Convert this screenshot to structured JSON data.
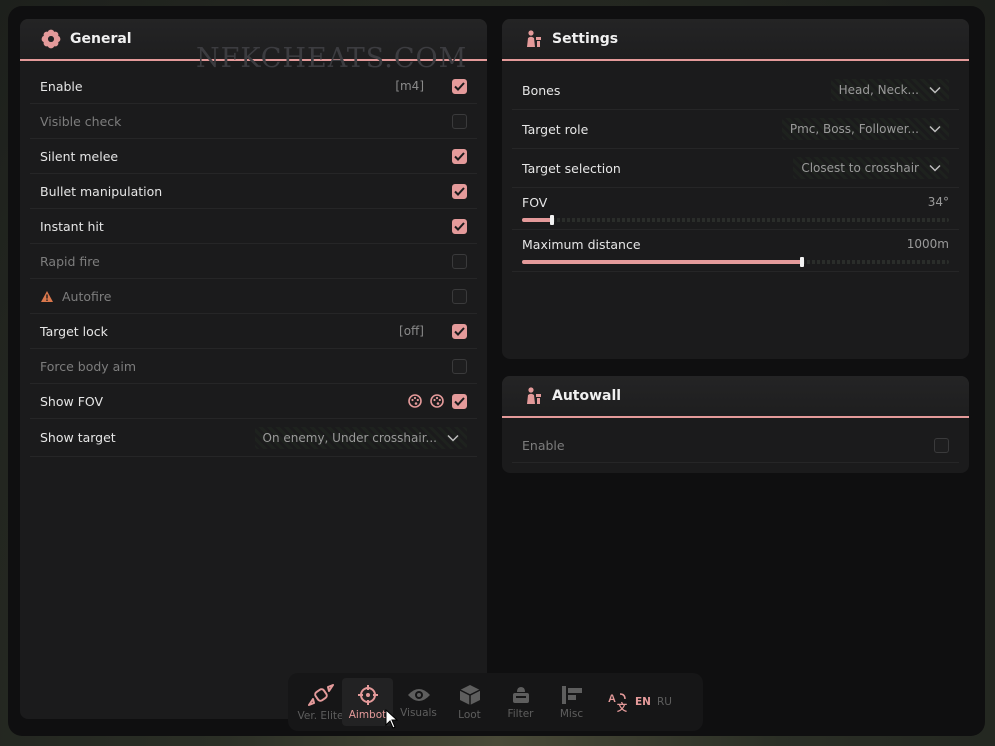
{
  "watermark": "NFKCHEATS.COM",
  "general": {
    "title": "General",
    "rows": [
      {
        "label": "Enable",
        "key": "[m4]",
        "checked": true,
        "disabled": false
      },
      {
        "label": "Visible check",
        "key": "",
        "checked": false,
        "disabled": true
      },
      {
        "label": "Silent melee",
        "key": "",
        "checked": true,
        "disabled": false
      },
      {
        "label": "Bullet manipulation",
        "key": "",
        "checked": true,
        "disabled": false
      },
      {
        "label": "Instant hit",
        "key": "",
        "checked": true,
        "disabled": false
      },
      {
        "label": "Rapid fire",
        "key": "",
        "checked": false,
        "disabled": true
      },
      {
        "label": "Autofire",
        "key": "",
        "checked": false,
        "disabled": true,
        "icon": "warning-icon"
      },
      {
        "label": "Target lock",
        "key": "[off]",
        "checked": true,
        "disabled": false
      },
      {
        "label": "Force body aim",
        "key": "",
        "checked": false,
        "disabled": true
      },
      {
        "label": "Show FOV",
        "key": "",
        "checked": true,
        "disabled": false,
        "colors": [
          "palette-icon",
          "palette-icon"
        ]
      }
    ],
    "show_target": {
      "label": "Show target",
      "value": "On enemy, Under crosshair..."
    }
  },
  "settings": {
    "title": "Settings",
    "dropdowns": [
      {
        "label": "Bones",
        "value": "Head, Neck..."
      },
      {
        "label": "Target role",
        "value": "Pmc, Boss, Follower..."
      },
      {
        "label": "Target selection",
        "value": "Closest to crosshair"
      }
    ],
    "sliders": [
      {
        "label": "FOV",
        "value_text": "34°",
        "fraction": 0.07
      },
      {
        "label": "Maximum distance",
        "value_text": "1000m",
        "fraction": 0.655
      }
    ]
  },
  "autowall": {
    "title": "Autowall",
    "enable_label": "Enable",
    "enabled": false
  },
  "nav": {
    "items": [
      {
        "name": "ver-elite",
        "label": "Ver. Elite",
        "icon": "candy-icon",
        "active": false
      },
      {
        "name": "aimbot",
        "label": "Aimbot",
        "icon": "crosshair-icon",
        "active": true
      },
      {
        "name": "visuals",
        "label": "Visuals",
        "icon": "eye-icon",
        "active": false
      },
      {
        "name": "loot",
        "label": "Loot",
        "icon": "box-icon",
        "active": false
      },
      {
        "name": "filter",
        "label": "Filter",
        "icon": "filter-icon",
        "active": false
      },
      {
        "name": "misc",
        "label": "Misc",
        "icon": "misc-icon",
        "active": false
      }
    ],
    "lang_en": "EN",
    "lang_ru": "RU"
  },
  "colors": {
    "accent": "#e49a9a",
    "panel": "#1b1b1c",
    "warning": "#d9774c"
  }
}
